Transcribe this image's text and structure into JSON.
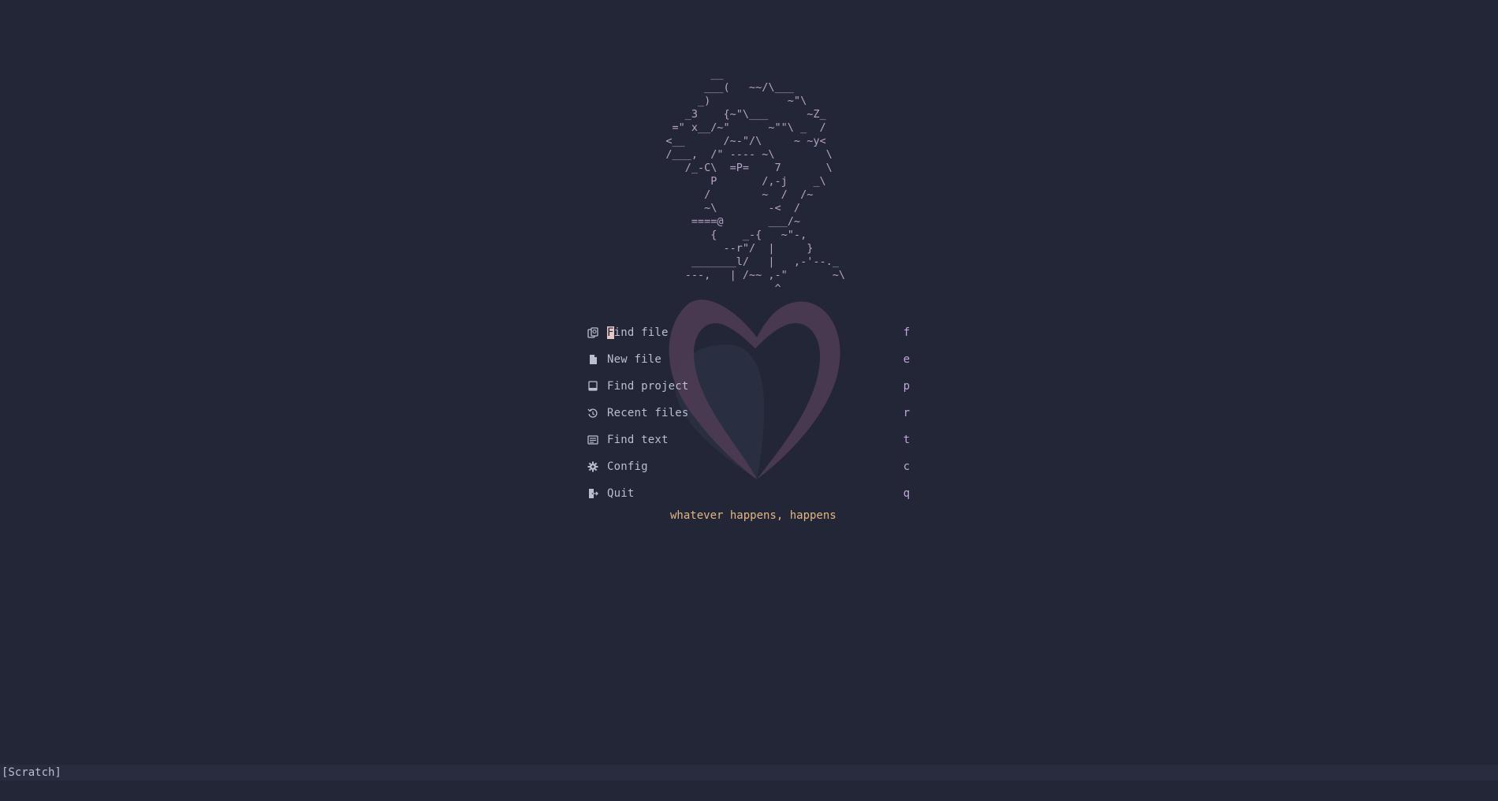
{
  "ascii_art": "          __\n         ___(   ~~/\\___\n        _)            ~\"\\\n      _3    {~\"\\___      ~Z_\n    =\" x__/~\"      ~\"\"\\ _  /\n   <__      /~-\"/\\     ~ ~y<\n   /___,  /\" ---- ~\\        \\\n      /_-C\\  =P=    7       \\\n          P       /,-j    _\\\n         /        ~  /  /~\n         ~\\        -<  /\n       ====@       ___/~\n          {    _-{   ~\"-,\n            --r\"/  |     }\n       _______l/   |   ,-'--._\n      ---,   | /~~ ,-\"       ~\\\n                    ^",
  "menu": [
    {
      "label": "Find file",
      "key": "f",
      "icon": "find-file-icon"
    },
    {
      "label": "New file",
      "key": "e",
      "icon": "new-file-icon"
    },
    {
      "label": "Find project",
      "key": "p",
      "icon": "project-icon"
    },
    {
      "label": "Recent files",
      "key": "r",
      "icon": "history-icon"
    },
    {
      "label": "Find text",
      "key": "t",
      "icon": "text-search-icon"
    },
    {
      "label": "Config",
      "key": "c",
      "icon": "gear-icon"
    },
    {
      "label": "Quit",
      "key": "q",
      "icon": "exit-icon"
    }
  ],
  "footer": {
    "quote": "whatever happens, happens"
  },
  "statusline": {
    "buffer_name": "[Scratch]"
  },
  "colors": {
    "background": "#232637",
    "ascii_art": "#b9a2c7",
    "menu_text": "#b9bed1",
    "shortcut_key": "#c3a5dd",
    "quote": "#e3b583",
    "logo": "#4b3a52"
  }
}
